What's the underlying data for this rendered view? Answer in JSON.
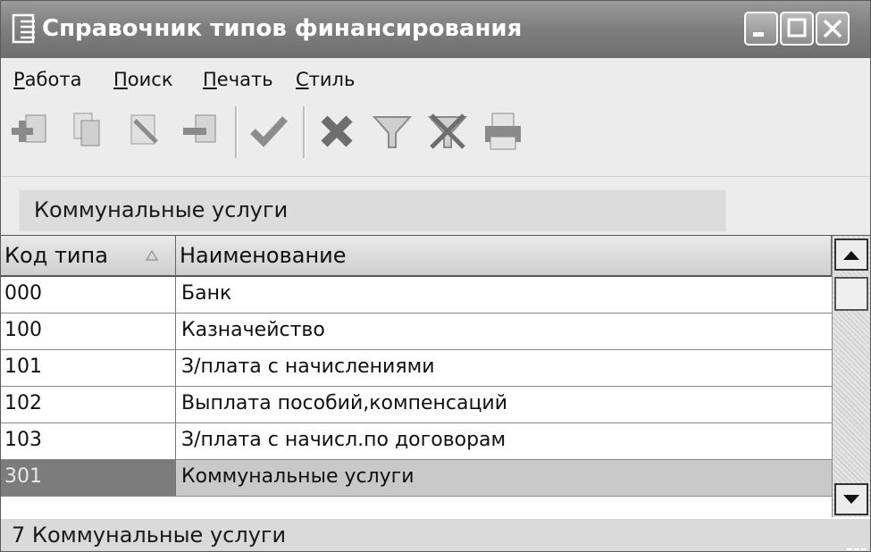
{
  "window": {
    "title": "Справочник типов финансирования"
  },
  "menu": [
    {
      "label": "Работа"
    },
    {
      "label": "Поиск"
    },
    {
      "label": "Печать"
    },
    {
      "label": "Стиль"
    }
  ],
  "toolbar": {
    "buttons": [
      "add-icon",
      "copy-icon",
      "edit-icon",
      "delete-icon",
      "checkmark-icon",
      "cancel-x-icon",
      "filter-icon",
      "clear-filter-icon",
      "print-icon"
    ]
  },
  "filter": {
    "value": "Коммунальные услуги"
  },
  "table": {
    "columns": [
      "Код типа",
      "Наименование"
    ],
    "sorted_column": 0,
    "rows": [
      {
        "code": "000",
        "name": "Банк"
      },
      {
        "code": "100",
        "name": "Казначейство"
      },
      {
        "code": "101",
        "name": "З/плата с начислениями"
      },
      {
        "code": "102",
        "name": "Выплата пособий,компенсаций"
      },
      {
        "code": "103",
        "name": "З/плата с начисл.по договорам"
      },
      {
        "code": "301",
        "name": "Коммунальные услуги"
      }
    ],
    "selected_row": 5
  },
  "status": {
    "text": "7 Коммунальные услуги"
  }
}
